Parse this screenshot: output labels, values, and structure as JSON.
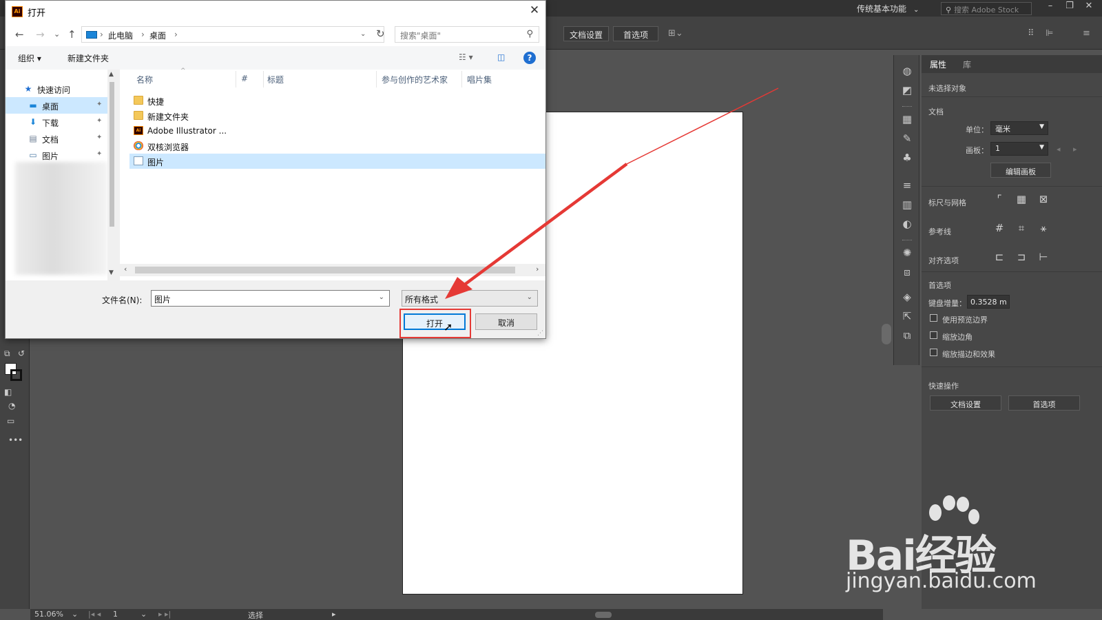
{
  "app": {
    "workspace": "传统基本功能",
    "stock_search_placeholder": "搜索 Adobe Stock",
    "control_bar": {
      "doc_setup": "文档设置",
      "preferences": "首选项"
    },
    "status": {
      "zoom": "51.06%",
      "artboard_num": "1",
      "tool_name": "选择"
    }
  },
  "properties_panel": {
    "tabs": [
      "属性",
      "库"
    ],
    "no_selection": "未选择对象",
    "section_document": "文档",
    "units_label": "单位：",
    "units_value": "毫米",
    "artboard_label": "画板：",
    "artboard_value": "1",
    "edit_artboards": "编辑画板",
    "rulers_grids": "标尺与网格",
    "guides": "参考线",
    "snap_options": "对齐选项",
    "section_prefs": "首选项",
    "keyboard_increment_label": "键盘增量：",
    "keyboard_increment_value": "0.3528 m",
    "chk_preview_bounds": "使用预览边界",
    "chk_scale_corners": "缩放边角",
    "chk_scale_strokes": "缩放描边和效果",
    "section_quick": "快速操作",
    "quick_doc_setup": "文档设置",
    "quick_prefs": "首选项"
  },
  "dialog": {
    "title": "打开",
    "app_icon": "Ai",
    "breadcrumb": [
      "此电脑",
      "桌面"
    ],
    "search_placeholder": "搜索\"桌面\"",
    "cmd_organize": "组织 ▾",
    "cmd_new_folder": "新建文件夹",
    "help": "?",
    "nav": {
      "quick_access": "快速访问",
      "items": [
        "桌面",
        "下载",
        "文档",
        "图片"
      ]
    },
    "columns": [
      "名称",
      "#",
      "标题",
      "参与创作的艺术家",
      "唱片集"
    ],
    "files": [
      {
        "name": "快捷",
        "icon": "folder-icon"
      },
      {
        "name": "新建文件夹",
        "icon": "folder-icon"
      },
      {
        "name": "Adobe Illustrator ...",
        "icon": "illustrator-icon"
      },
      {
        "name": "双核浏览器",
        "icon": "browser-icon"
      },
      {
        "name": "图片",
        "icon": "picture-file-icon"
      }
    ],
    "filename_label": "文件名(N):",
    "filename_value": "图片",
    "filetype_value": "所有格式",
    "open_btn": "打开",
    "cancel_btn": "取消"
  },
  "watermark": {
    "brand": "Bai经验",
    "url": "jingyan.baidu.com"
  },
  "colors": {
    "highlight": "#e53935",
    "selection": "#cce8ff",
    "primary_border": "#0078d7"
  }
}
